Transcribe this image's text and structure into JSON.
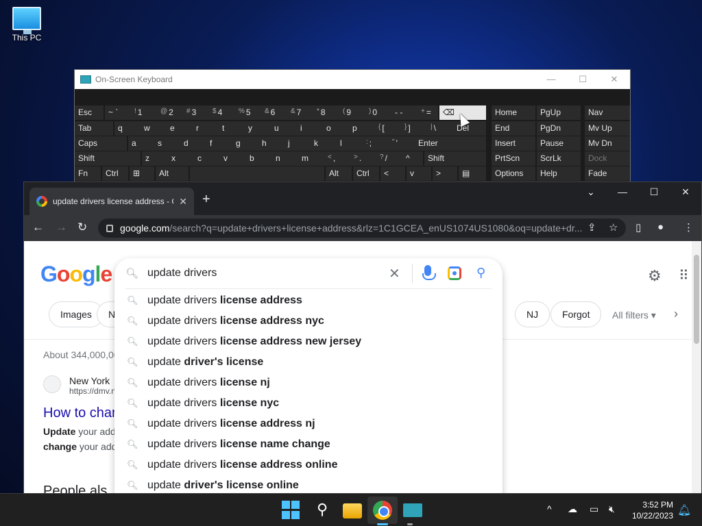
{
  "desktop": {
    "icon_label": "This PC"
  },
  "osk": {
    "title": "On-Screen Keyboard",
    "rows": [
      [
        [
          "Esc",
          "",
          0,
          42
        ],
        [
          "~ `",
          "",
          44,
          38
        ],
        [
          "1",
          "!",
          82,
          38
        ],
        [
          "2",
          "@",
          120,
          38
        ],
        [
          "3",
          "#",
          158,
          38
        ],
        [
          "4",
          "$",
          196,
          38
        ],
        [
          "5",
          "%",
          234,
          38
        ],
        [
          "6",
          "&",
          272,
          38
        ],
        [
          "7",
          "&",
          310,
          38
        ],
        [
          "8",
          "*",
          348,
          38
        ],
        [
          "9",
          "(",
          386,
          38
        ],
        [
          "0",
          ")",
          424,
          38
        ],
        [
          "- -",
          "",
          462,
          38
        ],
        [
          "=",
          "+",
          500,
          30
        ]
      ],
      [
        [
          "Tab",
          "",
          0,
          56
        ],
        [
          "q",
          "",
          58,
          38
        ],
        [
          "w",
          "",
          96,
          38
        ],
        [
          "e",
          "",
          134,
          38
        ],
        [
          "r",
          "",
          172,
          38
        ],
        [
          "t",
          "",
          210,
          38
        ],
        [
          "y",
          "",
          248,
          38
        ],
        [
          "u",
          "",
          286,
          38
        ],
        [
          "i",
          "",
          324,
          38
        ],
        [
          "o",
          "",
          362,
          38
        ],
        [
          "p",
          "",
          400,
          38
        ],
        [
          "[",
          "{",
          438,
          38
        ],
        [
          "]",
          "}",
          476,
          38
        ],
        [
          "\\",
          "|",
          514,
          38
        ],
        [
          "Del",
          "",
          552,
          48
        ]
      ],
      [
        [
          "Caps",
          "",
          0,
          76
        ],
        [
          "a",
          "",
          78,
          38
        ],
        [
          "s",
          "",
          116,
          38
        ],
        [
          "d",
          "",
          154,
          38
        ],
        [
          "f",
          "",
          192,
          38
        ],
        [
          "g",
          "",
          230,
          38
        ],
        [
          "h",
          "",
          268,
          38
        ],
        [
          "j",
          "",
          306,
          38
        ],
        [
          "k",
          "",
          344,
          38
        ],
        [
          "l",
          "",
          382,
          38
        ],
        [
          ";",
          ":",
          420,
          38
        ],
        [
          "'",
          "\"",
          458,
          38
        ],
        [
          "Enter",
          "",
          496,
          104
        ]
      ],
      [
        [
          "Shift",
          "",
          0,
          96
        ],
        [
          "z",
          "",
          98,
          38
        ],
        [
          "x",
          "",
          136,
          38
        ],
        [
          "c",
          "",
          174,
          38
        ],
        [
          "v",
          "",
          212,
          38
        ],
        [
          "b",
          "",
          250,
          38
        ],
        [
          "n",
          "",
          288,
          38
        ],
        [
          "m",
          "",
          326,
          38
        ],
        [
          ",",
          "<",
          364,
          38
        ],
        [
          ".",
          ">",
          402,
          38
        ],
        [
          "/",
          "?",
          440,
          38
        ],
        [
          "^",
          "",
          478,
          30
        ],
        [
          "Shift",
          "",
          510,
          90
        ]
      ],
      [
        [
          "Fn",
          "",
          0,
          38
        ],
        [
          "Ctrl",
          "",
          40,
          38
        ],
        [
          "⊞",
          "",
          80,
          36
        ],
        [
          "Alt",
          "",
          118,
          48
        ],
        [
          "",
          "",
          168,
          196
        ],
        [
          "Alt",
          "",
          366,
          38
        ],
        [
          "Ctrl",
          "",
          406,
          38
        ],
        [
          "<",
          "",
          446,
          36
        ],
        [
          "v",
          "",
          484,
          36
        ],
        [
          ">",
          "",
          522,
          36
        ],
        [
          "▤",
          "",
          560,
          40
        ]
      ]
    ],
    "backspace_symbol": "⌫",
    "right_keys": [
      [
        [
          "Home",
          608
        ],
        [
          "PgUp",
          674
        ],
        [
          "Nav",
          744
        ]
      ],
      [
        [
          "End",
          608
        ],
        [
          "PgDn",
          674
        ],
        [
          "Mv Up",
          744
        ]
      ],
      [
        [
          "Insert",
          608
        ],
        [
          "Pause",
          674
        ],
        [
          "Mv Dn",
          744
        ]
      ],
      [
        [
          "PrtScn",
          608
        ],
        [
          "ScrLk",
          674
        ],
        [
          "Dock",
          744
        ]
      ],
      [
        [
          "Options",
          608
        ],
        [
          "Help",
          674
        ],
        [
          "Fade",
          744
        ]
      ]
    ]
  },
  "browser": {
    "tab_title": "update drivers license address - Google Search",
    "url_host": "google.com",
    "url_rest": "/search?q=update+drivers+license+address&rlz=1C1GCEA_enUS1074US1080&oq=update+dr...",
    "logo": [
      "G",
      "o",
      "o",
      "g",
      "l",
      "e"
    ],
    "chips": [
      [
        "Images",
        36
      ],
      [
        "N",
        106
      ],
      [
        "NJ",
        716
      ],
      [
        "Forgot",
        768
      ]
    ],
    "all_filters": "All filters",
    "results_count": "About 344,000,00",
    "site_name": "New York",
    "site_url": "https://dmv.n",
    "result_title": "How to char",
    "snippet1_bold": "Update",
    "snippet1_text": " your add",
    "snippet2_bold": "change",
    "snippet2_text": " your add",
    "paa": "People als"
  },
  "search": {
    "value": "update drivers",
    "suggestions": [
      [
        "update drivers ",
        "license address"
      ],
      [
        "update drivers ",
        "license address nyc"
      ],
      [
        "update drivers ",
        "license address new jersey"
      ],
      [
        "update ",
        "driver's license"
      ],
      [
        "update drivers ",
        "license nj"
      ],
      [
        "update drivers ",
        "license nyc"
      ],
      [
        "update drivers ",
        "license address nj"
      ],
      [
        "update drivers ",
        "license name change"
      ],
      [
        "update drivers ",
        "license address online"
      ],
      [
        "update ",
        "driver's license online"
      ]
    ]
  },
  "taskbar": {
    "time": "3:52 PM",
    "date": "10/22/2023"
  }
}
